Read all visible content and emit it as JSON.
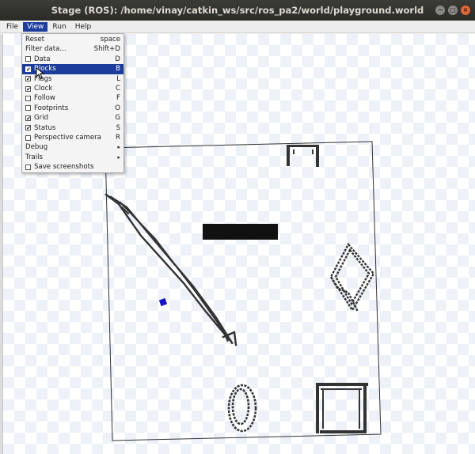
{
  "window": {
    "title": "Stage (ROS): /home/vinay/catkin_ws/src/ros_pa2/world/playground.world",
    "buttons": [
      "−",
      "□",
      "×"
    ]
  },
  "menubar": [
    {
      "label": "File",
      "active": false
    },
    {
      "label": "View",
      "active": true
    },
    {
      "label": "Run",
      "active": false
    },
    {
      "label": "Help",
      "active": false
    }
  ],
  "view_menu": {
    "items": [
      {
        "label": "Reset",
        "shortcut": "space",
        "checkbox": false
      },
      {
        "label": "Filter data...",
        "shortcut": "Shift+D",
        "checkbox": false
      },
      {
        "label": "Data",
        "shortcut": "D",
        "checkbox": true,
        "checked": false
      },
      {
        "label": "Blocks",
        "shortcut": "B",
        "checkbox": true,
        "checked": true,
        "highlighted": true
      },
      {
        "label": "Flags",
        "shortcut": "L",
        "checkbox": true,
        "checked": true
      },
      {
        "label": "Clock",
        "shortcut": "C",
        "checkbox": true,
        "checked": true
      },
      {
        "label": "Follow",
        "shortcut": "F",
        "checkbox": true,
        "checked": false
      },
      {
        "label": "Footprints",
        "shortcut": "O",
        "checkbox": true,
        "checked": false
      },
      {
        "label": "Grid",
        "shortcut": "G",
        "checkbox": true,
        "checked": true
      },
      {
        "label": "Status",
        "shortcut": "S",
        "checkbox": true,
        "checked": true
      },
      {
        "label": "Perspective camera",
        "shortcut": "R",
        "checkbox": true,
        "checked": false
      },
      {
        "label": "Debug",
        "shortcut": "▸",
        "checkbox": false,
        "submenu": true
      },
      {
        "label": "Trails",
        "shortcut": "▸",
        "checkbox": false,
        "submenu": true
      },
      {
        "label": "Save screenshots",
        "shortcut": "",
        "checkbox": true,
        "checked": false
      }
    ]
  },
  "colors": {
    "obstacle": "#333333",
    "robot": "#1414c8",
    "menu_highlight": "#1c3d9c"
  }
}
